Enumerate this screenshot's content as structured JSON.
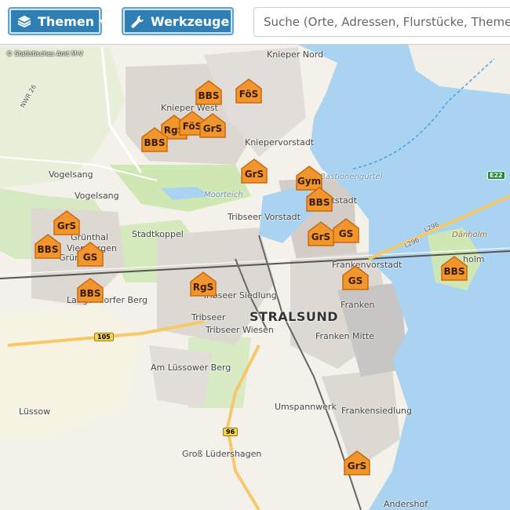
{
  "toolbar": {
    "themes_label": "Themen",
    "tools_label": "Werkzeuge",
    "search_placeholder": "Suche (Orte, Adressen, Flurstücke, Themen)"
  },
  "map": {
    "copyright": "© Statistisches Amt M-V",
    "places": [
      {
        "id": "knieper-nord",
        "label": "Knieper Nord",
        "cls": "mid"
      },
      {
        "id": "knieper-west",
        "label": "Knieper West",
        "cls": "mid"
      },
      {
        "id": "kniepervorstadt",
        "label": "Kniepervorstadt",
        "cls": "mid"
      },
      {
        "id": "vogelsang",
        "label": "Vogelsang",
        "cls": "mid"
      },
      {
        "id": "vogelsang2",
        "label": "Vogelsang",
        "cls": "mid"
      },
      {
        "id": "moorteich",
        "label": "Moorteich",
        "cls": "water"
      },
      {
        "id": "stadtkoppel",
        "label": "Stadtkoppel",
        "cls": "mid"
      },
      {
        "id": "tribseer-vorstadt",
        "label": "Tribseer Vorstadt",
        "cls": "mid"
      },
      {
        "id": "grunthal",
        "label": "Grünthal",
        "cls": "mid"
      },
      {
        "id": "viermorgen",
        "label": "Viermorgen",
        "cls": "mid"
      },
      {
        "id": "gruenhufe",
        "label": "Grünhufe",
        "cls": "mid"
      },
      {
        "id": "langendorfer-berg",
        "label": "Langendorfer Berg",
        "cls": "mid"
      },
      {
        "id": "tribseer-siedlung",
        "label": "Tribseer Siedlung",
        "cls": "mid"
      },
      {
        "id": "tribseer-wiesen",
        "label": "Tribseer Wiesen",
        "cls": "mid"
      },
      {
        "id": "stralsund",
        "label": "STRALSUND",
        "cls": "big"
      },
      {
        "id": "frankenvorstadt",
        "label": "Frankenvorstadt",
        "cls": "mid"
      },
      {
        "id": "franken-mitte",
        "label": "Franken Mitte",
        "cls": "mid"
      },
      {
        "id": "frankensiedlung",
        "label": "Frankensiedlung",
        "cls": "mid"
      },
      {
        "id": "am-luessower-berg",
        "label": "Am Lüssower Berg",
        "cls": "mid"
      },
      {
        "id": "luessow",
        "label": "Lüssow",
        "cls": "mid"
      },
      {
        "id": "gross-luedershagen",
        "label": "Groß Lüdershagen",
        "cls": "mid"
      },
      {
        "id": "andershof",
        "label": "Andershof",
        "cls": "mid"
      },
      {
        "id": "daenholm",
        "label": "Dänholm",
        "cls": "island"
      },
      {
        "id": "bastionenguertel",
        "label": "Bastionengürtel",
        "cls": "water"
      },
      {
        "id": "umspannwerk",
        "label": "Umspannwerk",
        "cls": "mid"
      },
      {
        "id": "franken",
        "label": "Franken",
        "cls": "mid"
      },
      {
        "id": "tribseer",
        "label": "Tribseer",
        "cls": "mid"
      },
      {
        "id": "altstadt",
        "label": "Altstadt",
        "cls": "mid"
      },
      {
        "id": "holm",
        "label": "holm",
        "cls": "mid"
      }
    ],
    "markers": [
      {
        "label": "BBS",
        "type": "berufsbildende-schule"
      },
      {
        "label": "FöS",
        "type": "foerderschule"
      },
      {
        "label": "RgS",
        "type": "regionale-schule"
      },
      {
        "label": "FöS",
        "type": "foerderschule"
      },
      {
        "label": "GrS",
        "type": "grundschule"
      },
      {
        "label": "BBS",
        "type": "berufsbildende-schule"
      },
      {
        "label": "GrS",
        "type": "grundschule"
      },
      {
        "label": "Gym",
        "type": "gymnasium"
      },
      {
        "label": "BBS",
        "type": "berufsbildende-schule"
      },
      {
        "label": "GrS",
        "type": "grundschule"
      },
      {
        "label": "GS",
        "type": "gesamtschule"
      },
      {
        "label": "GrS",
        "type": "grundschule"
      },
      {
        "label": "BBS",
        "type": "berufsbildende-schule"
      },
      {
        "label": "GS",
        "type": "gesamtschule"
      },
      {
        "label": "BBS",
        "type": "berufsbildende-schule"
      },
      {
        "label": "RgS",
        "type": "regionale-schule"
      },
      {
        "label": "GS",
        "type": "gesamtschule"
      },
      {
        "label": "BBS",
        "type": "berufsbildende-schule"
      },
      {
        "label": "GrS",
        "type": "grundschule"
      }
    ],
    "road_shields": [
      "105",
      "96",
      "E22",
      "L296",
      "L296"
    ],
    "road_labels": [
      "NWR 26"
    ]
  },
  "colors": {
    "water": "#a9d3f0",
    "land": "#f1efe8",
    "green": "#cfe7b3",
    "urban": "#d9d4d0",
    "button": "#2f7fb7",
    "marker": "#f0962d"
  }
}
